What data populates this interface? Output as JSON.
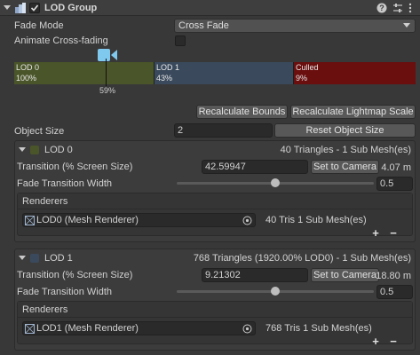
{
  "header": {
    "title": "LOD Group",
    "enabled": true
  },
  "fade_mode": {
    "label": "Fade Mode",
    "value": "Cross Fade"
  },
  "animate_cross_fading": {
    "label": "Animate Cross-fading",
    "checked": false
  },
  "lod_bar": {
    "segments": [
      {
        "name": "LOD 0",
        "percent": "100%",
        "color": "#4a5529"
      },
      {
        "name": "LOD 1",
        "percent": "43%",
        "color": "#3a4a5c"
      },
      {
        "name": "Culled",
        "percent": "9%",
        "color": "#6a0e0e"
      }
    ],
    "marker_label": "59%"
  },
  "buttons": {
    "recalculate_bounds": "Recalculate Bounds",
    "recalculate_lightmap_scale": "Recalculate Lightmap Scale",
    "reset_object_size": "Reset Object Size",
    "set_to_camera": "Set to Camera"
  },
  "object_size": {
    "label": "Object Size",
    "value": "2"
  },
  "lods": [
    {
      "title": "LOD 0",
      "summary": "40 Triangles  - 1 Sub Mesh(es)",
      "swatch_color": "#4a5529",
      "transition_label": "Transition (% Screen Size)",
      "transition_value": "42.59947",
      "distance": "4.07 m",
      "fade_label": "Fade Transition Width",
      "fade_value": "0.5",
      "fade_fraction": 0.5,
      "renderers_label": "Renderers",
      "renderer_name": "LOD0 (Mesh Renderer)",
      "renderer_info": "40 Tris 1 Sub Mesh(es)"
    },
    {
      "title": "LOD 1",
      "summary": "768 Triangles (1920.00% LOD0) - 1 Sub Mesh(es)",
      "swatch_color": "#3a4a5c",
      "transition_label": "Transition (% Screen Size)",
      "transition_value": "9.21302",
      "distance": "18.80 m",
      "fade_label": "Fade Transition Width",
      "fade_value": "0.5",
      "fade_fraction": 0.5,
      "renderers_label": "Renderers",
      "renderer_name": "LOD1 (Mesh Renderer)",
      "renderer_info": "768 Tris 1 Sub Mesh(es)"
    }
  ],
  "icons": {
    "foldout": "triangle-down-icon",
    "component": "lod-group-icon",
    "help": "help-icon",
    "settings": "sliders-icon",
    "more": "kebab-icon",
    "camera": "camera-icon",
    "mesh": "mesh-icon",
    "target": "object-picker-icon"
  },
  "list_controls": {
    "add": "+",
    "remove": "−"
  }
}
